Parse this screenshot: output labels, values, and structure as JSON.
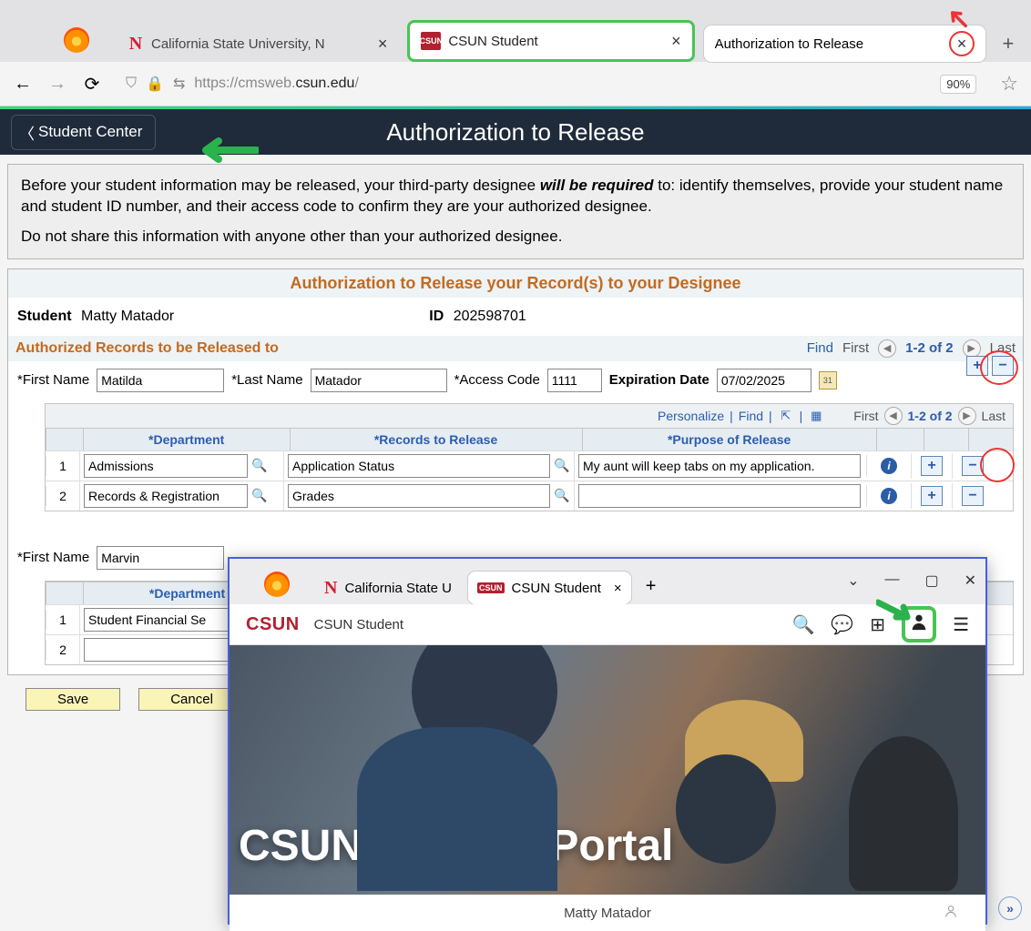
{
  "browser": {
    "tabs": [
      {
        "title": "California State University, N",
        "favicon": "N"
      },
      {
        "title": "CSUN Student",
        "favicon": "CSUN"
      },
      {
        "title": "Authorization to Release",
        "favicon": ""
      }
    ],
    "url_prefix": "https://cmsweb.",
    "url_host": "csun.edu",
    "url_suffix": "/",
    "zoom": "90%"
  },
  "appbar": {
    "back": "Student Center",
    "title": "Authorization to Release"
  },
  "notice": {
    "line1a": "Before your student information may be released, your third-party designee ",
    "line1b": "will be required",
    "line1c": " to: identify themselves, provide your student name and student ID number, and their access code to confirm they are your authorized designee.",
    "line2": "Do not share this information with anyone other than your authorized designee."
  },
  "section_title": "Authorization to Release your Record(s) to your Designee",
  "student": {
    "label": "Student",
    "name": "Matty Matador",
    "id_label": "ID",
    "id": "202598701"
  },
  "records_header": "Authorized Records to be Released to",
  "nav": {
    "find": "Find",
    "first": "First",
    "count": "1-2 of 2",
    "last": "Last"
  },
  "labels": {
    "first_name": "First Name",
    "last_name": "Last Name",
    "access_code": "Access Code",
    "exp_date": "Expiration Date",
    "department": "Department",
    "records": "Records to Release",
    "purpose": "Purpose of Release",
    "personalize": "Personalize"
  },
  "designee1": {
    "first": "Matilda",
    "last": "Matador",
    "code": "1111",
    "exp": "07/02/2025",
    "rows": [
      {
        "n": "1",
        "dept": "Admissions",
        "rec": "Application Status",
        "purp": "My aunt will keep tabs on my application."
      },
      {
        "n": "2",
        "dept": "Records & Registration",
        "rec": "Grades",
        "purp": ""
      }
    ]
  },
  "designee2": {
    "first": "Marvin",
    "rows": [
      {
        "n": "1",
        "dept": "Student Financial Se",
        "rec": "",
        "purp": ""
      },
      {
        "n": "2",
        "dept": "",
        "rec": "",
        "purp": ""
      }
    ]
  },
  "buttons": {
    "save": "Save",
    "cancel": "Cancel"
  },
  "popup": {
    "tabs": [
      {
        "title": "California State U"
      },
      {
        "title": "CSUN Student"
      }
    ],
    "brand": "CSUN",
    "page_title": "CSUN Student",
    "hero_title": "CSUN Student Portal",
    "footer_name": "Matty Matador"
  }
}
